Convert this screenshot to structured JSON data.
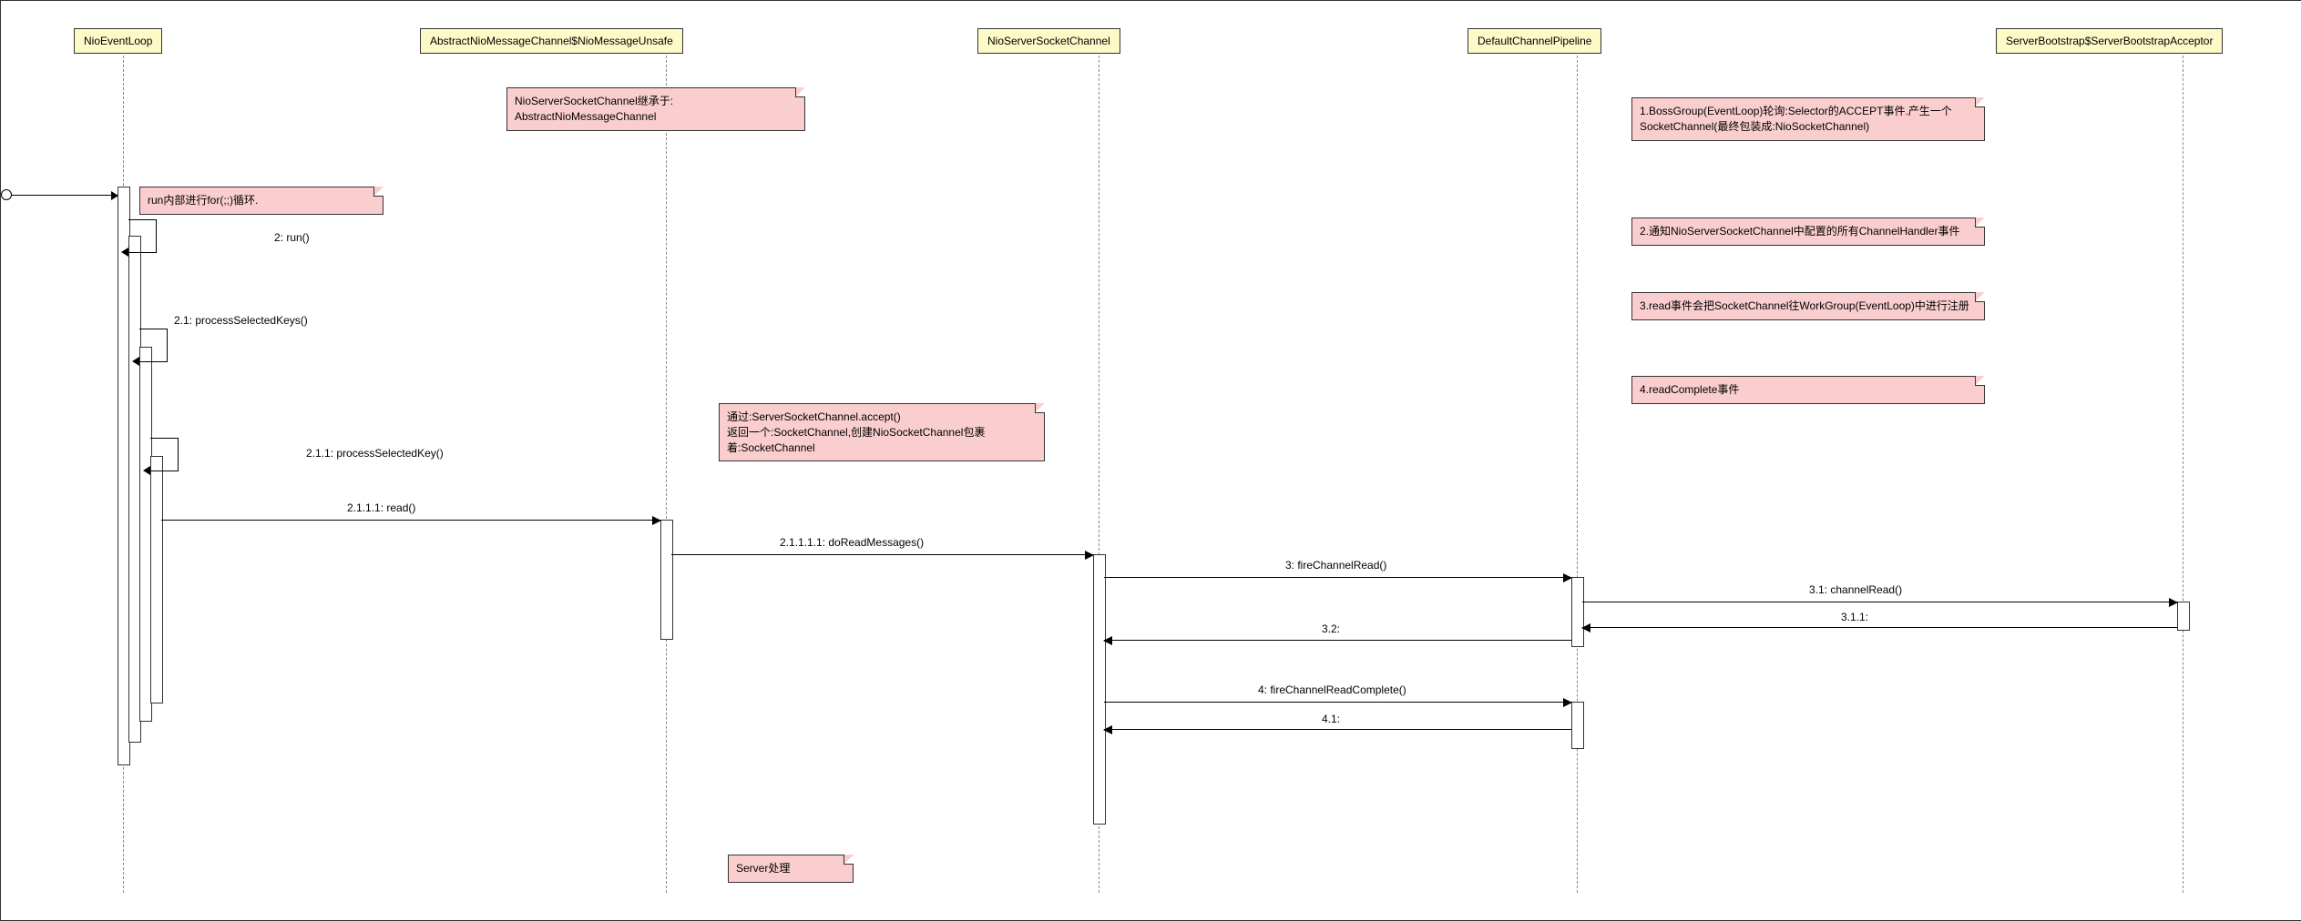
{
  "participants": {
    "p1": "NioEventLoop",
    "p2": "AbstractNioMessageChannel$NioMessageUnsafe",
    "p3": "NioServerSocketChannel",
    "p4": "DefaultChannelPipeline",
    "p5": "ServerBootstrap$ServerBootstrapAcceptor"
  },
  "notes": {
    "n1": "run内部进行for(;;)循环.",
    "n2": "NioServerSocketChannel继承于:\nAbstractNioMessageChannel",
    "n3": "通过:ServerSocketChannel.accept()\n返回一个:SocketChannel,创建NioSocketChannel包裹着:SocketChannel",
    "n4": "1.BossGroup(EventLoop)轮询:Selector的ACCEPT事件.产生一个SocketChannel(最终包装成:NioSocketChannel)",
    "n5": "2.通知NioServerSocketChannel中配置的所有ChannelHandler事件",
    "n6": "3.read事件会把SocketChannel往WorkGroup(EventLoop)中进行注册",
    "n7": "4.readComplete事件",
    "n8": "Server处理"
  },
  "messages": {
    "m2": "2: run()",
    "m21": "2.1: processSelectedKeys()",
    "m211": "2.1.1: processSelectedKey()",
    "m2111": "2.1.1.1: read()",
    "m21111": "2.1.1.1.1: doReadMessages()",
    "m3": "3: fireChannelRead()",
    "m31": "3.1: channelRead()",
    "m311": "3.1.1:",
    "m32": "3.2:",
    "m4": "4: fireChannelReadComplete()",
    "m41": "4.1:"
  }
}
